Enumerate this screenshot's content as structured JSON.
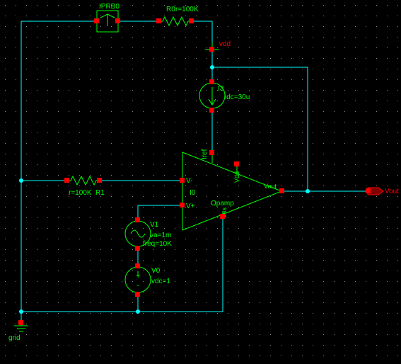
{
  "probe": {
    "label": "IPRB0"
  },
  "R0": {
    "name": "R0",
    "value": "r=100K"
  },
  "R1": {
    "name": "R1",
    "value": "r=100K"
  },
  "vdd": {
    "label": "vdd"
  },
  "I3": {
    "name": "I3",
    "value": "idc=30u"
  },
  "opamp": {
    "inst": "I0",
    "type": "Opamp",
    "vminus": "V-",
    "vplus": "V+",
    "iref": "Iref",
    "vdd": "Vdd",
    "vss": "Vss",
    "vout": "Vout"
  },
  "V1": {
    "name": "V1",
    "va": "va=1m",
    "freq": "freq=10K"
  },
  "V0": {
    "name": "V0",
    "value": "vdc=1"
  },
  "gnd": {
    "label": "gnd"
  },
  "vout_pin": {
    "label": "Vout"
  },
  "chart_data": {
    "type": "schematic",
    "components": [
      {
        "ref": "IPRB0",
        "type": "current_probe"
      },
      {
        "ref": "R0",
        "type": "resistor",
        "value": "100K"
      },
      {
        "ref": "R1",
        "type": "resistor",
        "value": "100K"
      },
      {
        "ref": "I3",
        "type": "idc_source",
        "value": "30u"
      },
      {
        "ref": "I0",
        "type": "opamp",
        "model": "Opamp"
      },
      {
        "ref": "V1",
        "type": "vsine",
        "va": "1m",
        "freq": "10K"
      },
      {
        "ref": "V0",
        "type": "vdc",
        "value": "1"
      }
    ],
    "nets": [
      "vdd",
      "Vout",
      "gnd"
    ],
    "connections": [
      "R1 between input node and V- of opamp",
      "R0 feedback from Vout to V- (through IPRB0)",
      "V1 series V0 to V+ of opamp, other end to gnd",
      "I3 from vdd to Iref of opamp",
      "opamp Vdd to vdd net, Vss to gnd",
      "Vout net to output pin"
    ]
  }
}
